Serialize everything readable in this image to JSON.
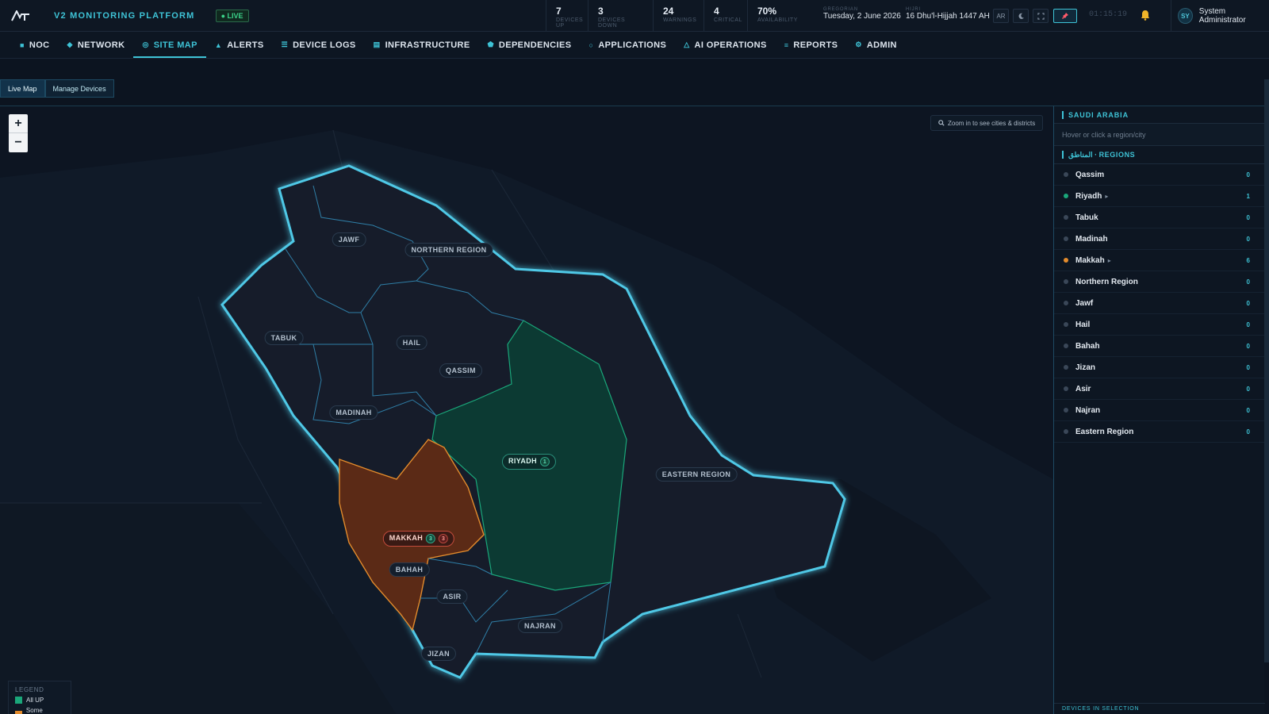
{
  "app": {
    "title": "V2 MONITORING PLATFORM",
    "live_label": "● LIVE"
  },
  "stats": [
    {
      "value": "7",
      "label": "DEVICES UP"
    },
    {
      "value": "3",
      "label": "DEVICES DOWN"
    },
    {
      "value": "24",
      "label": "WARNINGS"
    },
    {
      "value": "4",
      "label": "CRITICAL"
    },
    {
      "value": "70%",
      "label": "AVAILABILITY"
    }
  ],
  "dates": {
    "gregorian_caption": "GREGORIAN",
    "gregorian": "Tuesday, 2 June 2026",
    "hijri_caption": "HIJRI",
    "hijri": "16 Dhu'l-Hijjah 1447 AH"
  },
  "toolbar": {
    "lang_label": "AR",
    "theme_icon": "moon-icon",
    "fullscreen_icon": "fullscreen-icon",
    "pin_icon": "pin-icon",
    "clock": "01:15:19"
  },
  "user": {
    "initials": "SY",
    "name": "System Administrator"
  },
  "nav": [
    {
      "label": "NOC",
      "icon": "■",
      "active": false
    },
    {
      "label": "NETWORK",
      "icon": "◆",
      "active": false
    },
    {
      "label": "SITE MAP",
      "icon": "◎",
      "active": true
    },
    {
      "label": "ALERTS",
      "icon": "▲",
      "active": false
    },
    {
      "label": "DEVICE LOGS",
      "icon": "☰",
      "active": false
    },
    {
      "label": "INFRASTRUCTURE",
      "icon": "▤",
      "active": false
    },
    {
      "label": "DEPENDENCIES",
      "icon": "⬟",
      "active": false
    },
    {
      "label": "APPLICATIONS",
      "icon": "○",
      "active": false
    },
    {
      "label": "AI OPERATIONS",
      "icon": "△",
      "active": false
    },
    {
      "label": "REPORTS",
      "icon": "≡",
      "active": false
    },
    {
      "label": "ADMIN",
      "icon": "⚙",
      "active": false
    }
  ],
  "subtabs": {
    "live_map": "Live Map",
    "manage_devices": "Manage Devices"
  },
  "map": {
    "zoom_in": "+",
    "zoom_out": "−",
    "zoom_hint": "Zoom in to see cities & districts",
    "labels": {
      "jawf": "JAWF",
      "northern": "NORTHERN REGION",
      "tabuk": "TABUK",
      "hail": "HAIL",
      "qassim": "QASSIM",
      "madinah": "MADINAH",
      "riyadh": "RIYADH",
      "riyadh_up": "1",
      "eastern": "EASTERN REGION",
      "makkah": "MAKKAH",
      "makkah_up": "3",
      "makkah_down": "3",
      "bahah": "BAHAH",
      "asir": "ASIR",
      "najran": "NAJRAN",
      "jizan": "JIZAN"
    },
    "legend": {
      "caption": "LEGEND",
      "all_up": "All UP",
      "some_down": "Some DOWN"
    },
    "colors": {
      "all_up": "#1aa77a",
      "some_down": "#e38b2c",
      "outline": "#4fc8e6"
    }
  },
  "panel": {
    "country": "SAUDI ARABIA",
    "hint": "Hover or click a region/city",
    "regions_title": "المناطق · REGIONS",
    "regions": [
      {
        "name": "Qassim",
        "count": "0",
        "status": "none",
        "arrow": ""
      },
      {
        "name": "Riyadh",
        "count": "1",
        "status": "up",
        "arrow": "▸"
      },
      {
        "name": "Tabuk",
        "count": "0",
        "status": "none",
        "arrow": ""
      },
      {
        "name": "Madinah",
        "count": "0",
        "status": "none",
        "arrow": ""
      },
      {
        "name": "Makkah",
        "count": "6",
        "status": "partial",
        "arrow": "▸"
      },
      {
        "name": "Northern Region",
        "count": "0",
        "status": "none",
        "arrow": ""
      },
      {
        "name": "Jawf",
        "count": "0",
        "status": "none",
        "arrow": ""
      },
      {
        "name": "Hail",
        "count": "0",
        "status": "none",
        "arrow": ""
      },
      {
        "name": "Bahah",
        "count": "0",
        "status": "none",
        "arrow": ""
      },
      {
        "name": "Jizan",
        "count": "0",
        "status": "none",
        "arrow": ""
      },
      {
        "name": "Asir",
        "count": "0",
        "status": "none",
        "arrow": ""
      },
      {
        "name": "Najran",
        "count": "0",
        "status": "none",
        "arrow": ""
      },
      {
        "name": "Eastern Region",
        "count": "0",
        "status": "none",
        "arrow": ""
      }
    ],
    "footer": "DEVICES IN SELECTION"
  }
}
